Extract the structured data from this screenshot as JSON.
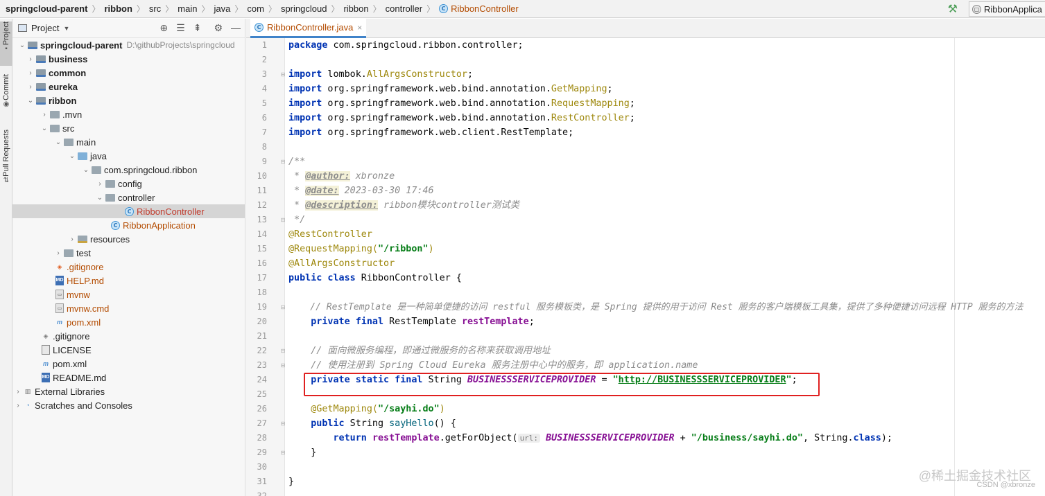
{
  "breadcrumb": {
    "items": [
      "springcloud-parent",
      "ribbon",
      "src",
      "main",
      "java",
      "com",
      "springcloud",
      "ribbon",
      "controller",
      "RibbonController"
    ],
    "run_config": "RibbonApplica"
  },
  "tool_window_tabs": [
    "Project",
    "Commit",
    "Pull Requests"
  ],
  "project_panel": {
    "title": "Project",
    "tree": [
      {
        "label": "springcloud-parent",
        "path": "D:\\githubProjects\\springcloud"
      },
      {
        "label": "business"
      },
      {
        "label": "common"
      },
      {
        "label": "eureka"
      },
      {
        "label": "ribbon"
      },
      {
        "label": ".mvn"
      },
      {
        "label": "src"
      },
      {
        "label": "main"
      },
      {
        "label": "java"
      },
      {
        "label": "com.springcloud.ribbon"
      },
      {
        "label": "config"
      },
      {
        "label": "controller"
      },
      {
        "label": "RibbonController"
      },
      {
        "label": "RibbonApplication"
      },
      {
        "label": "resources"
      },
      {
        "label": "test"
      },
      {
        "label": ".gitignore"
      },
      {
        "label": "HELP.md"
      },
      {
        "label": "mvnw"
      },
      {
        "label": "mvnw.cmd"
      },
      {
        "label": "pom.xml"
      },
      {
        "label": ".gitignore"
      },
      {
        "label": "LICENSE"
      },
      {
        "label": "pom.xml"
      },
      {
        "label": "README.md"
      },
      {
        "label": "External Libraries"
      },
      {
        "label": "Scratches and Consoles"
      }
    ]
  },
  "editor": {
    "tab_label": "RibbonController.java",
    "line_numbers": [
      "1",
      "2",
      "3",
      "4",
      "5",
      "6",
      "7",
      "8",
      "9",
      "10",
      "11",
      "12",
      "13",
      "14",
      "15",
      "16",
      "17",
      "18",
      "19",
      "20",
      "21",
      "22",
      "23",
      "24",
      "25",
      "26",
      "27",
      "28",
      "29",
      "30",
      "31",
      "32"
    ],
    "code": {
      "l1_kw": "package",
      "l1_rest": " com.springcloud.ribbon.controller;",
      "l3_kw": "import",
      "l3_pkg": " lombok.",
      "l3_cls": "AllArgsConstructor",
      "l3_end": ";",
      "l4_kw": "import",
      "l4_pkg": " org.springframework.web.bind.annotation.",
      "l4_cls": "GetMapping",
      "l4_end": ";",
      "l5_kw": "import",
      "l5_pkg": " org.springframework.web.bind.annotation.",
      "l5_cls": "RequestMapping",
      "l5_end": ";",
      "l6_kw": "import",
      "l6_pkg": " org.springframework.web.bind.annotation.",
      "l6_cls": "RestController",
      "l6_end": ";",
      "l7_kw": "import",
      "l7_rest": " org.springframework.web.client.RestTemplate;",
      "l9": "/**",
      "l10_pre": " * ",
      "l10_tag": "@author:",
      "l10_val": " xbronze",
      "l11_pre": " * ",
      "l11_tag": "@date:",
      "l11_val": " 2023-03-30 17:46",
      "l12_pre": " * ",
      "l12_tag": "@description:",
      "l12_val": " ribbon模块controller测试类",
      "l13": " */",
      "l14": "@RestController",
      "l15_an": "@RequestMapping(",
      "l15_str": "\"/ribbon\"",
      "l15_end": ")",
      "l16": "@AllArgsConstructor",
      "l17_kw": "public class",
      "l17_rest": " RibbonController {",
      "l19": "    // RestTemplate 是一种简单便捷的访问 restful 服务模板类，是 Spring 提供的用于访问 Rest 服务的客户端模板工具集，提供了多种便捷访问远程 HTTP 服务的方法",
      "l20_kw": "    private final",
      "l20_type": " RestTemplate ",
      "l20_fld": "restTemplate",
      "l20_end": ";",
      "l22": "    // 面向微服务编程，即通过微服务的名称来获取调用地址",
      "l23": "    // 使用注册到 Spring Cloud Eureka 服务注册中心中的服务，即 application.name",
      "l24_kw": "    private static final",
      "l24_type": " String ",
      "l24_const": "BUSINESSSERVICEPROVIDER",
      "l24_eq": " = ",
      "l24_q1": "\"",
      "l24_url": "http://BUSINESSSERVICEPROVIDER",
      "l24_q2": "\"",
      "l24_end": ";",
      "l26_an": "    @GetMapping(",
      "l26_str": "\"/sayhi.do\"",
      "l26_end": ")",
      "l27_kw": "    public",
      "l27_type": " String ",
      "l27_mth": "sayHello",
      "l27_end": "() {",
      "l28_kw": "        return",
      "l28_sp": " ",
      "l28_fld": "restTemplate",
      "l28_mid": ".getForObject(",
      "l28_hint": "url:",
      "l28_const": " BUSINESSSERVICEPROVIDER",
      "l28_plus": " + ",
      "l28_str": "\"/business/sayhi.do\"",
      "l28_tail": ", String.",
      "l28_cls": "class",
      "l28_end": ");",
      "l29": "    }",
      "l31": "}"
    }
  },
  "watermark": {
    "line1": "@稀土掘金技术社区",
    "line2": "CSDN @xbronze"
  },
  "colors": {
    "keyword": "#0033b3",
    "string": "#067d17",
    "annotation": "#9e880d",
    "comment": "#8c8c8c",
    "highlight_box": "#e02020"
  }
}
